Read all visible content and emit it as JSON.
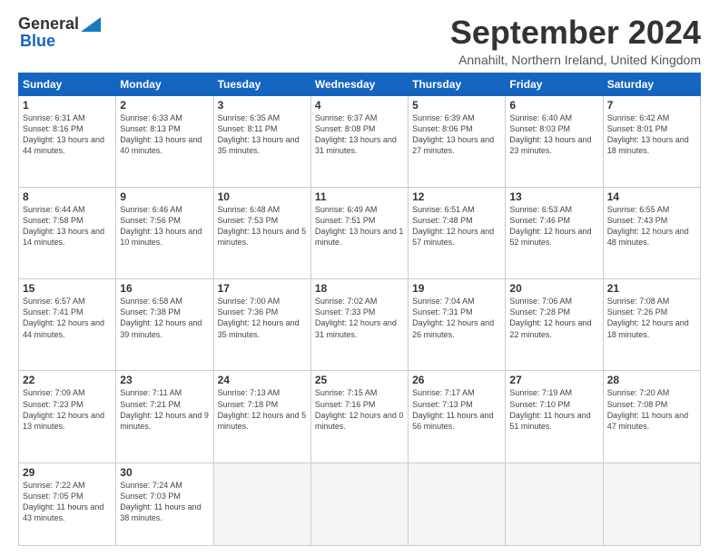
{
  "logo": {
    "general": "General",
    "blue": "Blue"
  },
  "title": "September 2024",
  "location": "Annahilt, Northern Ireland, United Kingdom",
  "days_header": [
    "Sunday",
    "Monday",
    "Tuesday",
    "Wednesday",
    "Thursday",
    "Friday",
    "Saturday"
  ],
  "weeks": [
    [
      {
        "day": "1",
        "sunrise": "6:31 AM",
        "sunset": "8:16 PM",
        "daylight": "13 hours and 44 minutes."
      },
      {
        "day": "2",
        "sunrise": "6:33 AM",
        "sunset": "8:13 PM",
        "daylight": "13 hours and 40 minutes."
      },
      {
        "day": "3",
        "sunrise": "6:35 AM",
        "sunset": "8:11 PM",
        "daylight": "13 hours and 35 minutes."
      },
      {
        "day": "4",
        "sunrise": "6:37 AM",
        "sunset": "8:08 PM",
        "daylight": "13 hours and 31 minutes."
      },
      {
        "day": "5",
        "sunrise": "6:39 AM",
        "sunset": "8:06 PM",
        "daylight": "13 hours and 27 minutes."
      },
      {
        "day": "6",
        "sunrise": "6:40 AM",
        "sunset": "8:03 PM",
        "daylight": "13 hours and 23 minutes."
      },
      {
        "day": "7",
        "sunrise": "6:42 AM",
        "sunset": "8:01 PM",
        "daylight": "13 hours and 18 minutes."
      }
    ],
    [
      {
        "day": "8",
        "sunrise": "6:44 AM",
        "sunset": "7:58 PM",
        "daylight": "13 hours and 14 minutes."
      },
      {
        "day": "9",
        "sunrise": "6:46 AM",
        "sunset": "7:56 PM",
        "daylight": "13 hours and 10 minutes."
      },
      {
        "day": "10",
        "sunrise": "6:48 AM",
        "sunset": "7:53 PM",
        "daylight": "13 hours and 5 minutes."
      },
      {
        "day": "11",
        "sunrise": "6:49 AM",
        "sunset": "7:51 PM",
        "daylight": "13 hours and 1 minute."
      },
      {
        "day": "12",
        "sunrise": "6:51 AM",
        "sunset": "7:48 PM",
        "daylight": "12 hours and 57 minutes."
      },
      {
        "day": "13",
        "sunrise": "6:53 AM",
        "sunset": "7:46 PM",
        "daylight": "12 hours and 52 minutes."
      },
      {
        "day": "14",
        "sunrise": "6:55 AM",
        "sunset": "7:43 PM",
        "daylight": "12 hours and 48 minutes."
      }
    ],
    [
      {
        "day": "15",
        "sunrise": "6:57 AM",
        "sunset": "7:41 PM",
        "daylight": "12 hours and 44 minutes."
      },
      {
        "day": "16",
        "sunrise": "6:58 AM",
        "sunset": "7:38 PM",
        "daylight": "12 hours and 39 minutes."
      },
      {
        "day": "17",
        "sunrise": "7:00 AM",
        "sunset": "7:36 PM",
        "daylight": "12 hours and 35 minutes."
      },
      {
        "day": "18",
        "sunrise": "7:02 AM",
        "sunset": "7:33 PM",
        "daylight": "12 hours and 31 minutes."
      },
      {
        "day": "19",
        "sunrise": "7:04 AM",
        "sunset": "7:31 PM",
        "daylight": "12 hours and 26 minutes."
      },
      {
        "day": "20",
        "sunrise": "7:06 AM",
        "sunset": "7:28 PM",
        "daylight": "12 hours and 22 minutes."
      },
      {
        "day": "21",
        "sunrise": "7:08 AM",
        "sunset": "7:26 PM",
        "daylight": "12 hours and 18 minutes."
      }
    ],
    [
      {
        "day": "22",
        "sunrise": "7:09 AM",
        "sunset": "7:23 PM",
        "daylight": "12 hours and 13 minutes."
      },
      {
        "day": "23",
        "sunrise": "7:11 AM",
        "sunset": "7:21 PM",
        "daylight": "12 hours and 9 minutes."
      },
      {
        "day": "24",
        "sunrise": "7:13 AM",
        "sunset": "7:18 PM",
        "daylight": "12 hours and 5 minutes."
      },
      {
        "day": "25",
        "sunrise": "7:15 AM",
        "sunset": "7:16 PM",
        "daylight": "12 hours and 0 minutes."
      },
      {
        "day": "26",
        "sunrise": "7:17 AM",
        "sunset": "7:13 PM",
        "daylight": "11 hours and 56 minutes."
      },
      {
        "day": "27",
        "sunrise": "7:19 AM",
        "sunset": "7:10 PM",
        "daylight": "11 hours and 51 minutes."
      },
      {
        "day": "28",
        "sunrise": "7:20 AM",
        "sunset": "7:08 PM",
        "daylight": "11 hours and 47 minutes."
      }
    ],
    [
      {
        "day": "29",
        "sunrise": "7:22 AM",
        "sunset": "7:05 PM",
        "daylight": "11 hours and 43 minutes."
      },
      {
        "day": "30",
        "sunrise": "7:24 AM",
        "sunset": "7:03 PM",
        "daylight": "11 hours and 38 minutes."
      },
      null,
      null,
      null,
      null,
      null
    ]
  ]
}
